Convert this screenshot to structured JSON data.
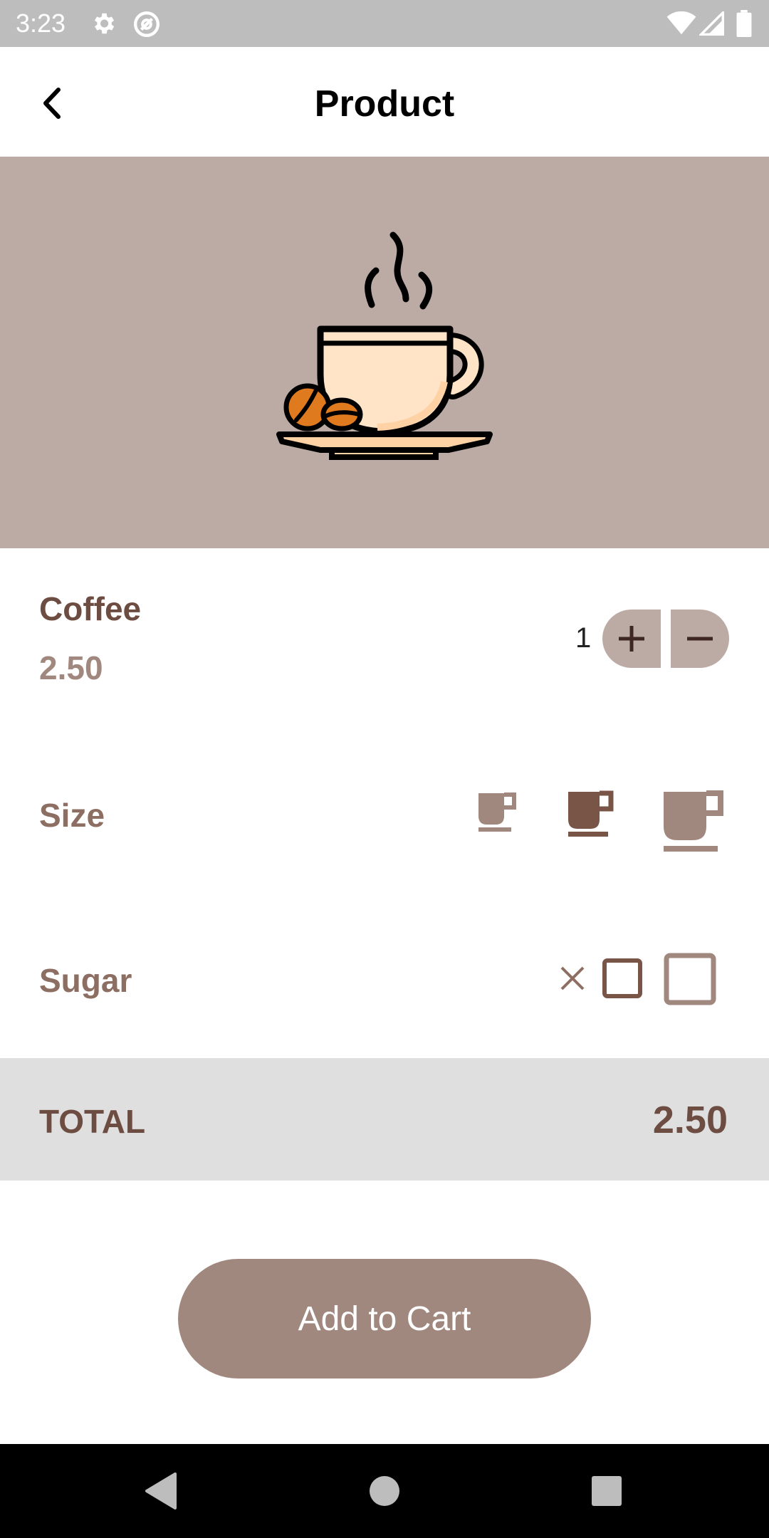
{
  "status_bar": {
    "time": "3:23",
    "icons": [
      "gear-icon",
      "at-sign-icon",
      "wifi-icon",
      "signal-icon",
      "battery-icon"
    ]
  },
  "app_bar": {
    "title": "Product",
    "back_icon": "chevron-left-icon"
  },
  "hero": {
    "image": "coffee-cup-illustration"
  },
  "product": {
    "name": "Coffee",
    "price": "2.50",
    "quantity": "1",
    "increment_icon": "plus-icon",
    "decrement_icon": "minus-icon"
  },
  "size": {
    "label": "Size",
    "options": [
      "small-cup-icon",
      "medium-cup-icon",
      "large-cup-icon"
    ],
    "selected": "medium-cup-icon"
  },
  "sugar": {
    "label": "Sugar",
    "options": [
      "no-sugar-icon",
      "one-sugar-icon",
      "two-sugar-icon"
    ]
  },
  "total": {
    "label": "TOTAL",
    "value": "2.50"
  },
  "actions": {
    "add_to_cart": "Add to Cart"
  },
  "colors": {
    "accent_dark": "#6d4c41",
    "accent": "#a1887f",
    "hero_background": "#bcaba4",
    "selected_size": "#795548",
    "total_background": "#dfdfdf"
  },
  "nav_bar": {
    "icons": [
      "back-triangle-icon",
      "home-circle-icon",
      "recents-square-icon"
    ]
  }
}
